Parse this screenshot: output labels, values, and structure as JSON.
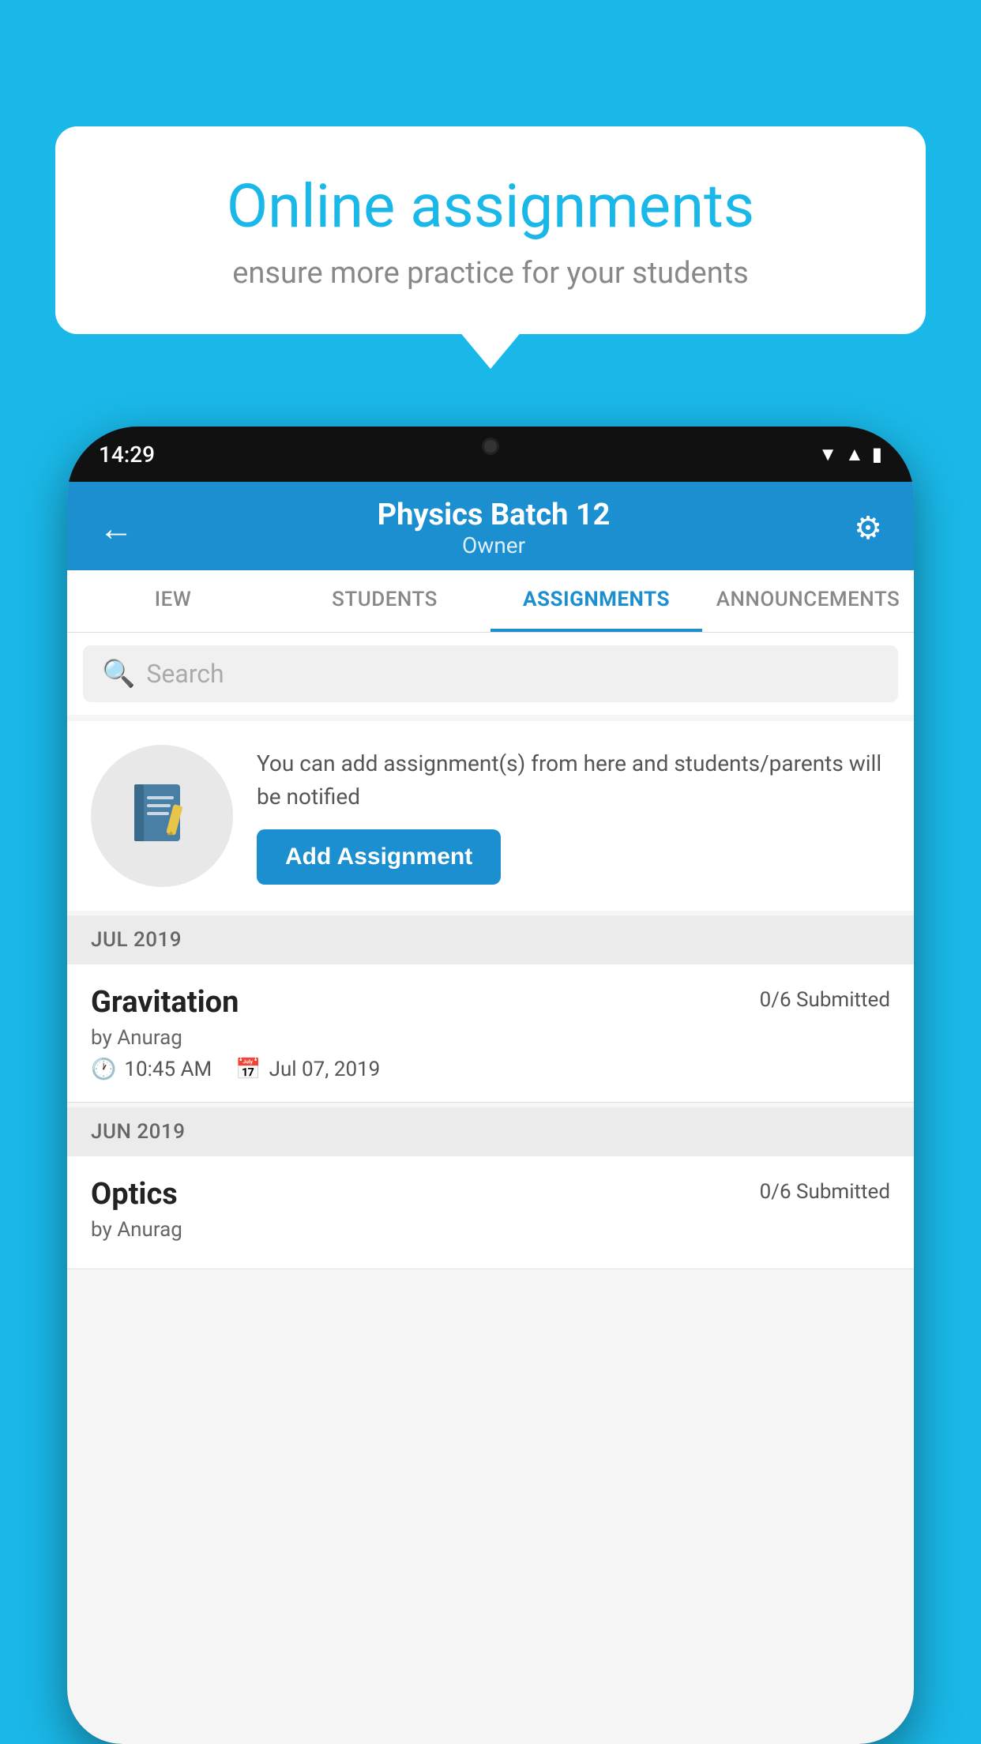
{
  "background_color": "#1ab8e8",
  "speech_bubble": {
    "title": "Online assignments",
    "subtitle": "ensure more practice for your students"
  },
  "phone": {
    "status_time": "14:29",
    "header": {
      "title": "Physics Batch 12",
      "subtitle": "Owner",
      "back_icon": "←",
      "settings_icon": "⚙"
    },
    "tabs": [
      {
        "label": "IEW",
        "active": false
      },
      {
        "label": "STUDENTS",
        "active": false
      },
      {
        "label": "ASSIGNMENTS",
        "active": true
      },
      {
        "label": "ANNOUNCEMENTS",
        "active": false
      }
    ],
    "search": {
      "placeholder": "Search"
    },
    "promo": {
      "text": "You can add assignment(s) from here and students/parents will be notified",
      "button_label": "Add Assignment"
    },
    "assignments": [
      {
        "month_label": "JUL 2019",
        "name": "Gravitation",
        "submitted": "0/6 Submitted",
        "by": "by Anurag",
        "time": "10:45 AM",
        "date": "Jul 07, 2019"
      },
      {
        "month_label": "JUN 2019",
        "name": "Optics",
        "submitted": "0/6 Submitted",
        "by": "by Anurag",
        "time": "",
        "date": ""
      }
    ]
  }
}
